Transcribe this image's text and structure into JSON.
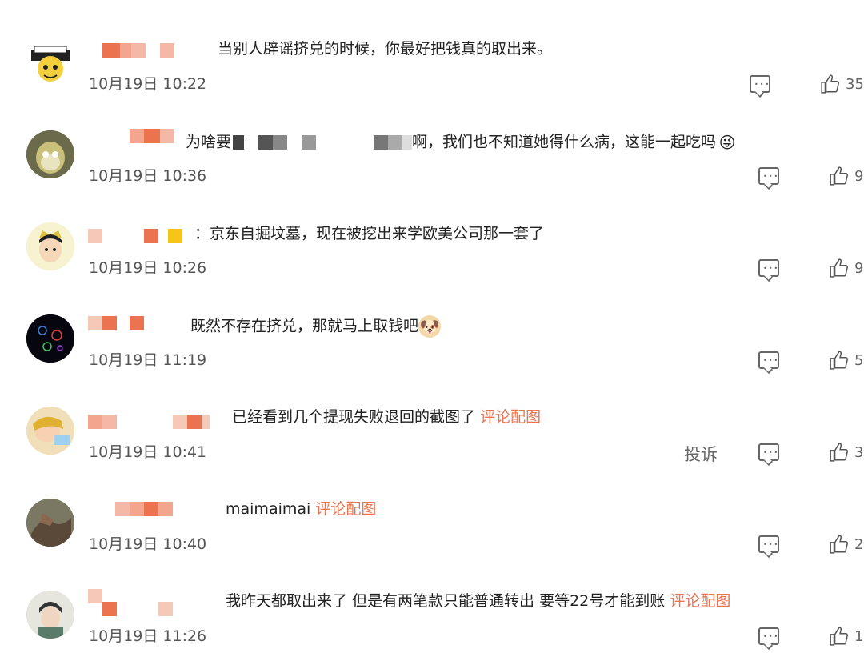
{
  "comments": [
    {
      "text": "当别人辟谣挤兑的时候，你最好把钱真的取出来。",
      "time": "10月19日 10:22",
      "likes": "35",
      "avatar_icon": "cartoon-avatar-icon",
      "colors": {
        "avatar_bg": "#ffffff",
        "name_color": "#eb7350"
      }
    },
    {
      "text": "为啥要",
      "text2": "啊，我们也不知道她得什么病，这能一起吃吗",
      "time": "10月19日 10:36",
      "likes": "9",
      "avatar_icon": "cartoon-avatar-icon",
      "emoji": "😜"
    },
    {
      "text": "京东自掘坟墓，现在被挖出来学欧美公司那一套了",
      "time": "10月19日 10:26",
      "likes": "9",
      "avatar_icon": "cartoon-avatar-icon"
    },
    {
      "text": "既然不存在挤兑，那就马上取钱吧",
      "time": "10月19日 11:19",
      "likes": "5",
      "avatar_icon": "dark-avatar-icon",
      "emoji": "🐶"
    },
    {
      "text": "已经看到几个提现失败退回的截图了",
      "link": "评论配图",
      "time": "10月19日 10:41",
      "likes": "3",
      "report": "投诉",
      "avatar_icon": "cartoon-avatar-icon"
    },
    {
      "text": "maimaimai",
      "link": "评论配图",
      "time": "10月19日 10:40",
      "likes": "2",
      "avatar_icon": "photo-avatar-icon"
    },
    {
      "text": "我昨天都取出来了 但是有两笔款只能普通转出 要等22号才能到账",
      "link": "评论配图",
      "time": "10月19日 11:26",
      "likes": "1",
      "avatar_icon": "photo-avatar-icon"
    }
  ]
}
